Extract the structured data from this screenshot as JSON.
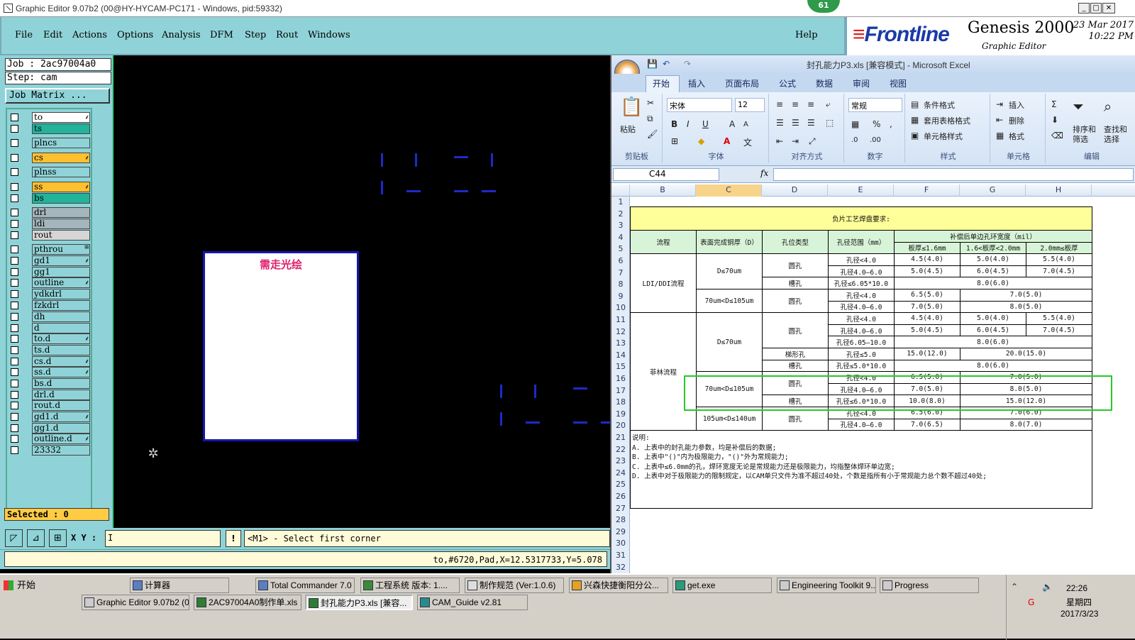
{
  "window": {
    "title": "Graphic Editor 9.07b2 (00@HY-HYCAM-PC171 - Windows, pid:59332)",
    "badge": "61"
  },
  "menu": [
    "File",
    "Edit",
    "Actions",
    "Options",
    "Analysis",
    "DFM",
    "Step",
    "Rout",
    "Windows"
  ],
  "help": "Help",
  "brand": {
    "logo": "Frontline",
    "product": "Genesis 2000",
    "subtitle": "Graphic Editor",
    "date": "23 Mar 2017",
    "time": "10:22 PM"
  },
  "job": {
    "job": "Job : 2ac97004a0",
    "step": "Step: cam",
    "matrix_button": "Job Matrix ..."
  },
  "layers": [
    {
      "name": "to",
      "color": "#ffffff",
      "mark": "⸙"
    },
    {
      "name": "ts",
      "color": "#22b39a",
      "mark": ""
    },
    {
      "name": "plncs",
      "color": "#8fd3d8",
      "mark": ""
    },
    {
      "name": "cs",
      "color": "#ffc030",
      "mark": "⸙"
    },
    {
      "name": "plnss",
      "color": "#8fd3d8",
      "mark": ""
    },
    {
      "name": "ss",
      "color": "#ffc030",
      "mark": "⸙"
    },
    {
      "name": "bs",
      "color": "#22b39a",
      "mark": ""
    },
    {
      "name": "drl",
      "color": "#a6b4bb",
      "mark": ""
    },
    {
      "name": "ldi",
      "color": "#a6b4bb",
      "mark": ""
    },
    {
      "name": "rout",
      "color": "#d6d6d6",
      "mark": ""
    },
    {
      "name": "pthrou",
      "color": "#8fd3d8",
      "mark": "≡"
    },
    {
      "name": "gd1",
      "color": "#8fd3d8",
      "mark": "⸙"
    },
    {
      "name": "gg1",
      "color": "#8fd3d8",
      "mark": ""
    },
    {
      "name": "outline",
      "color": "#8fd3d8",
      "mark": "⸙"
    },
    {
      "name": "ydkdrl",
      "color": "#8fd3d8",
      "mark": ""
    },
    {
      "name": "fzkdrl",
      "color": "#8fd3d8",
      "mark": ""
    },
    {
      "name": "dh",
      "color": "#8fd3d8",
      "mark": ""
    },
    {
      "name": "d",
      "color": "#8fd3d8",
      "mark": ""
    },
    {
      "name": "to.d",
      "color": "#8fd3d8",
      "mark": "⸙"
    },
    {
      "name": "ts.d",
      "color": "#8fd3d8",
      "mark": ""
    },
    {
      "name": "cs.d",
      "color": "#8fd3d8",
      "mark": "⸙"
    },
    {
      "name": "ss.d",
      "color": "#8fd3d8",
      "mark": "⸙"
    },
    {
      "name": "bs.d",
      "color": "#8fd3d8",
      "mark": ""
    },
    {
      "name": "drl.d",
      "color": "#8fd3d8",
      "mark": ""
    },
    {
      "name": "rout.d",
      "color": "#8fd3d8",
      "mark": ""
    },
    {
      "name": "gd1.d",
      "color": "#8fd3d8",
      "mark": "⸙"
    },
    {
      "name": "gg1.d",
      "color": "#8fd3d8",
      "mark": ""
    },
    {
      "name": "outline.d",
      "color": "#8fd3d8",
      "mark": "⸙"
    },
    {
      "name": "23332",
      "color": "#8fd3d8",
      "mark": ""
    }
  ],
  "selected": "Selected : 0",
  "canvas": {
    "box_label": "需走光绘"
  },
  "coords": {
    "label": "X Y :",
    "value": "I",
    "warn": "!",
    "prompt": "<M1> - Select first corner"
  },
  "status": "to,#6720,Pad,X=12.5317733,Y=5.078",
  "excel": {
    "title": "封孔能力P3.xls [兼容模式] - Microsoft Excel",
    "tabs": [
      "开始",
      "插入",
      "页面布局",
      "公式",
      "数据",
      "审阅",
      "视图"
    ],
    "ribbon": {
      "paste": "粘贴",
      "clipboard": "剪贴板",
      "font_name": "宋体",
      "font_size": "12",
      "font": "字体",
      "align": "对齐方式",
      "number_format": "常规",
      "number": "数字",
      "cond_format": "条件格式",
      "table_format": "套用表格格式",
      "cell_style": "单元格样式",
      "styles": "样式",
      "insert": "插入",
      "delete": "删除",
      "format": "格式",
      "cells": "单元格",
      "sort": "排序和筛选",
      "find": "查找和选择",
      "edit": "编辑"
    },
    "namebox": "C44",
    "fx": "fx",
    "columns": [
      "B",
      "C",
      "D",
      "E",
      "F",
      "G",
      "H"
    ],
    "rows": [
      "1",
      "2",
      "3",
      "4",
      "5",
      "6",
      "7",
      "8",
      "9",
      "10",
      "11",
      "12",
      "13",
      "14",
      "15",
      "16",
      "17",
      "18",
      "19",
      "20",
      "21",
      "22",
      "23",
      "24",
      "25",
      "26",
      "27",
      "28",
      "29",
      "30",
      "31",
      "32"
    ],
    "sheet": {
      "title": "负片工艺焊盘要求:",
      "h_flow": "流程",
      "h_cu": "表面完成铜厚（D）",
      "h_type": "孔位类型",
      "h_range": "孔径范围（mm）",
      "h_ring": "补偿后单边孔环宽度（mil）",
      "h_t1": "板厚≤1.6mm",
      "h_t2": "1.6<板厚<2.0mm",
      "h_t3": "2.0mm≤板厚",
      "ldi": "LDI/DDI流程",
      "film": "菲林流程",
      "d70": "D≤70um",
      "d105": "70um<D≤105um",
      "d140": "105um<D≤140um",
      "round": "圆孔",
      "slot": "槽孔",
      "special": "梯形孔",
      "r_lt4": "孔径<4.0",
      "r_4_6": "孔径4.0—6.0",
      "r_slot": "孔径≤6.05*10.0",
      "r_605_10": "孔径6.05—10.0",
      "r_le5": "孔径≤5.0",
      "r_slot5": "孔径≤5.0*10.0",
      "r_slot6": "孔径≤6.0*10.0",
      "v": {
        "a1": "4.5(4.0)",
        "a2": "5.0(4.0)",
        "a3": "5.5(4.0)",
        "b1": "5.0(4.5)",
        "b2": "6.0(4.5)",
        "b3": "7.0(4.5)",
        "c": "8.0(6.0)",
        "d1": "6.5(5.0)",
        "d2": "7.0(5.0)",
        "e1": "7.0(5.0)",
        "e2": "8.0(5.0)",
        "f1": "15.0(12.0)",
        "f2": "20.0(15.0)",
        "g1": "10.0(8.0)",
        "g2": "15.0(12.0)",
        "h1": "6.5(6.0)",
        "h2": "7.0(6.0)",
        "i1": "7.0(6.5)",
        "i2": "8.0(7.0)"
      },
      "notes": [
        "说明:",
        "A. 上表中的封孔能力参数，均是补偿后的数据;",
        "B. 上表中\"()\"内为极限能力，\"()\"外为常规能力;",
        "C. 上表中≤6.0mm的孔，焊环宽度无论是常规能力还是极限能力，均指整体焊环单边宽;",
        "D. 上表中对于极限能力的限制规定，以CAM单只文件为准不超过40处，个数是指所有小于常规能力总个数不超过40处;"
      ]
    }
  },
  "taskbar": {
    "start": "开始",
    "row1": [
      "计算器",
      "Total Commander 7.0 ...",
      "工程系统  版本: 1....",
      "制作规范 (Ver:1.0.6)",
      "兴森快捷衡阳分公...",
      "get.exe",
      "Engineering Toolkit 9....",
      "Progress"
    ],
    "row2": [
      "Graphic Editor 9.07b2 (0...",
      "2AC97004A0制作单.xls ...",
      "封孔能力P3.xls [兼容...",
      "CAM_Guide v2.81"
    ],
    "time": "22:26",
    "day": "星期四",
    "date": "2017/3/23"
  }
}
